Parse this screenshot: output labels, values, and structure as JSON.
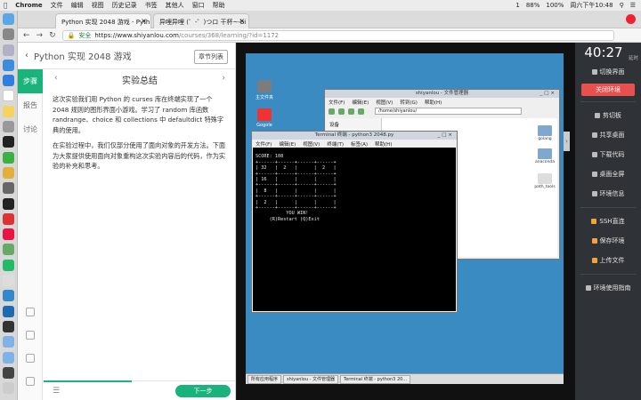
{
  "menubar": {
    "app": "Chrome",
    "items": [
      "文件",
      "编辑",
      "视图",
      "历史记录",
      "书签",
      "其他人",
      "窗口",
      "帮助"
    ],
    "battery": "88%",
    "battery2": "100%",
    "clock": "周六下午10:48",
    "badge": "1"
  },
  "browser": {
    "tabs": [
      {
        "label": "Python 实现 2048 游戏 - Pyth"
      },
      {
        "label": "异哩异哩 (゜-゜)つロ 干杯~-bi"
      }
    ],
    "url_secure": "安全",
    "url_host": "https://www.shiyanlou.com",
    "url_path": "/courses/368/learning/?id=1172"
  },
  "course": {
    "title": "Python 实现 2048 游戏",
    "outline_button": "章节列表",
    "side_tabs": [
      "步骤",
      "报告",
      "讨论"
    ],
    "section_title": "实验总结",
    "paragraph1": "这次实验我们用 Python 的 curses 库在终端实现了一个 2048 规则的图形界面小游戏。学习了 random 库函数 randrange、choice 和 collections 中 defaultdict 特殊字典的使用。",
    "paragraph2": "在实验过程中，我们仅部分使用了面向对象的开发方法。下面为大家提供使用面向对象重构这次实验内容后的代码，作为实验的补充和思考。",
    "next_button": "下一步",
    "progress": 0.46
  },
  "vnc": {
    "desktop_icons": [
      "主文件夹",
      "Gogole"
    ],
    "file_manager": {
      "title": "shiyanlou - 文件管理器",
      "menu": [
        "文件(F)",
        "编辑(E)",
        "视图(V)",
        "转到(G)",
        "帮助(H)"
      ],
      "path": "/home/shiyanlou/",
      "sidebar_heading": "设备",
      "folders": [
        "golang",
        "anaconda",
        "path_tools"
      ]
    },
    "terminal": {
      "title": "Terminal 终端 - python3 2048.py",
      "menu": [
        "文件(F)",
        "编辑(E)",
        "视图(V)",
        "终端(T)",
        "标签(A)",
        "帮助(H)"
      ],
      "lines": [
        "SCORE: 108",
        "+------+------+------+------+",
        "| 32   |  2   |      |  2   |",
        "+------+------+------+------+",
        "| 16   |      |      |      |",
        "+------+------+------+------+",
        "|  8   |      |      |      |",
        "+------+------+------+------+",
        "|  2   |      |      |      |",
        "+------+------+------+------+",
        "           YOU WIN!",
        "     (R)Restart (Q)Exit"
      ]
    },
    "taskbar": [
      "所有应用程序",
      "shiyanlou - 文件管理器",
      "Terminal 终端 - python3 20..."
    ]
  },
  "sidepanel": {
    "timer": "40:27",
    "extend": "延时",
    "switch_ui": "切换界面",
    "close_env": "关闭环境",
    "items": [
      "剪切板",
      "共享桌面",
      "下载代码",
      "桌面全屏",
      "环境信息"
    ],
    "items2": [
      "SSH直连",
      "保存环境",
      "上传文件"
    ],
    "guide": "环境使用指南"
  },
  "colors": {
    "accent": "#19b37b",
    "close": "#e8504e",
    "panel": "#2f3236",
    "desktop": "#3a8bc1"
  }
}
